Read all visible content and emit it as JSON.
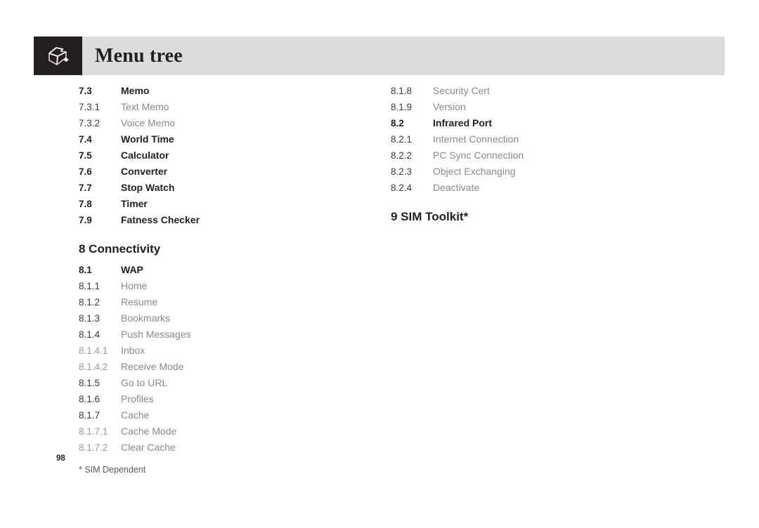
{
  "header": {
    "title": "Menu tree",
    "icon": "folder-icon",
    "icon_block_color": "#231f20",
    "bar_color": "#dcdcde"
  },
  "columns": {
    "left": [
      {
        "kind": "row",
        "level": 2,
        "number": "7.3",
        "label": "Memo"
      },
      {
        "kind": "row",
        "level": 3,
        "number": "7.3.1",
        "label": "Text Memo"
      },
      {
        "kind": "row",
        "level": 3,
        "number": "7.3.2",
        "label": "Voice Memo"
      },
      {
        "kind": "row",
        "level": 2,
        "number": "7.4",
        "label": "World Time"
      },
      {
        "kind": "row",
        "level": 2,
        "number": "7.5",
        "label": "Calculator"
      },
      {
        "kind": "row",
        "level": 2,
        "number": "7.6",
        "label": "Converter"
      },
      {
        "kind": "row",
        "level": 2,
        "number": "7.7",
        "label": "Stop Watch"
      },
      {
        "kind": "row",
        "level": 2,
        "number": "7.8",
        "label": "Timer"
      },
      {
        "kind": "row",
        "level": 2,
        "number": "7.9",
        "label": "Fatness Checker"
      },
      {
        "kind": "heading",
        "text": "8 Connectivity"
      },
      {
        "kind": "row",
        "level": 2,
        "number": "8.1",
        "label": "WAP"
      },
      {
        "kind": "row",
        "level": 3,
        "number": "8.1.1",
        "label": "Home"
      },
      {
        "kind": "row",
        "level": 3,
        "number": "8.1.2",
        "label": "Resume"
      },
      {
        "kind": "row",
        "level": 3,
        "number": "8.1.3",
        "label": "Bookmarks"
      },
      {
        "kind": "row",
        "level": 3,
        "number": "8.1.4",
        "label": "Push Messages"
      },
      {
        "kind": "row",
        "level": 4,
        "number": "8.1.4.1",
        "label": "Inbox"
      },
      {
        "kind": "row",
        "level": 4,
        "number": "8.1.4.2",
        "label": "Receive Mode"
      },
      {
        "kind": "row",
        "level": 3,
        "number": "8.1.5",
        "label": "Go to URL"
      },
      {
        "kind": "row",
        "level": 3,
        "number": "8.1.6",
        "label": "Profiles"
      },
      {
        "kind": "row",
        "level": 3,
        "number": "8.1.7",
        "label": "Cache"
      },
      {
        "kind": "row",
        "level": 4,
        "number": "8.1.7.1",
        "label": "Cache Mode"
      },
      {
        "kind": "row",
        "level": 4,
        "number": "8.1.7.2",
        "label": "Clear Cache"
      }
    ],
    "right": [
      {
        "kind": "row",
        "level": 3,
        "number": "8.1.8",
        "label": "Security Cert"
      },
      {
        "kind": "row",
        "level": 3,
        "number": "8.1.9",
        "label": "Version"
      },
      {
        "kind": "row",
        "level": 2,
        "number": "8.2",
        "label": "Infrared Port"
      },
      {
        "kind": "row",
        "level": 3,
        "number": "8.2.1",
        "label": "Internet Connection"
      },
      {
        "kind": "row",
        "level": 3,
        "number": "8.2.2",
        "label": "PC Sync Connection"
      },
      {
        "kind": "row",
        "level": 3,
        "number": "8.2.3",
        "label": "Object Exchanging"
      },
      {
        "kind": "row",
        "level": 3,
        "number": "8.2.4",
        "label": "Deactivate"
      },
      {
        "kind": "heading",
        "text": "9 SIM Toolkit*"
      }
    ]
  },
  "footer": {
    "page_number": "98",
    "footnote": "* SIM Dependent"
  }
}
